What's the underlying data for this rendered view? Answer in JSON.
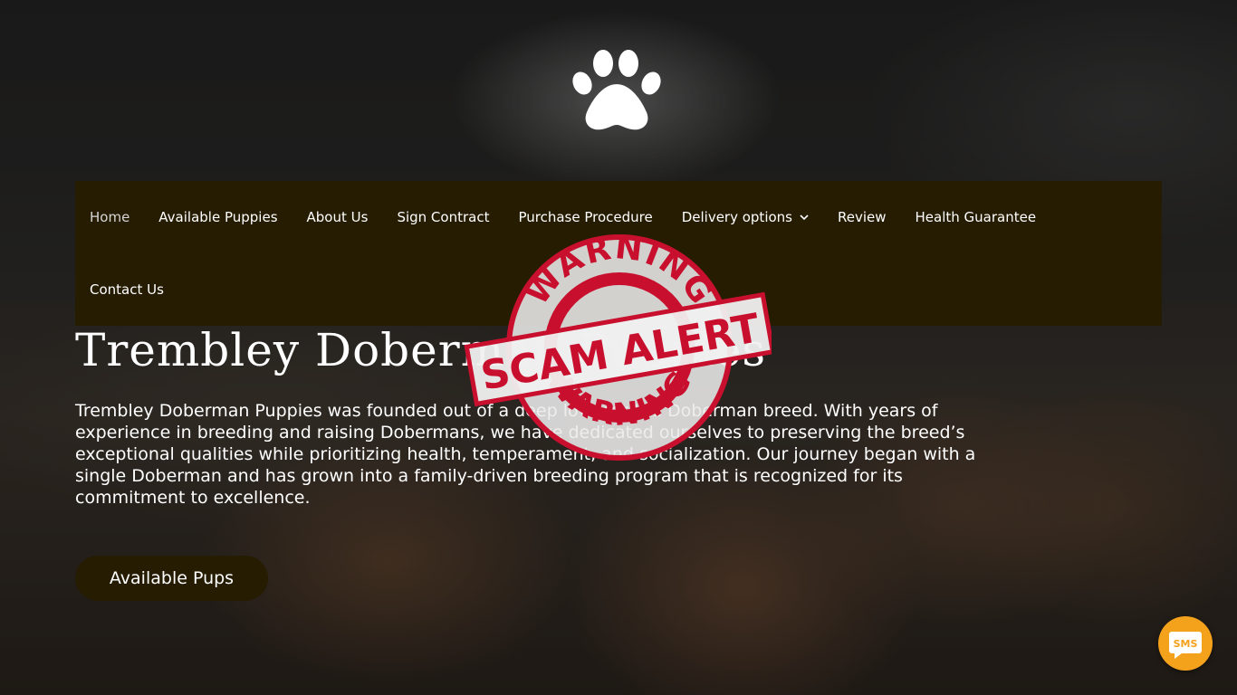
{
  "nav": {
    "row1": [
      {
        "label": "Home",
        "active": true
      },
      {
        "label": "Available Puppies"
      },
      {
        "label": "About Us"
      },
      {
        "label": "Sign Contract"
      },
      {
        "label": "Purchase Procedure"
      },
      {
        "label": "Delivery options",
        "has_dropdown": true
      },
      {
        "label": "Review"
      },
      {
        "label": "Health Guarantee"
      }
    ],
    "row2": [
      {
        "label": "Contact Us"
      }
    ]
  },
  "hero": {
    "title": "Trembley Doberman Puppies",
    "description": "Trembley Doberman Puppies was founded out of a deep love for the Doberman breed. With years of experience in breeding and raising Dobermans, we have dedicated ourselves to preserving the breed’s exceptional qualities while prioritizing health, temperament, and socialization. Our journey began with a single Doberman and has grown into a family-driven breeding program that is recognized for its commitment to excellence.",
    "cta_label": "Available Pups"
  },
  "stamp": {
    "top_text": "WARNING",
    "banner_text": "SCAM ALERT",
    "bottom_text": "WARNING"
  },
  "sms_widget": {
    "label": "SMS"
  },
  "icons": {
    "logo": "paw-print-icon",
    "dropdown": "chevron-down-icon",
    "sms": "sms-chat-icon"
  },
  "colors": {
    "nav_background": "#261c02",
    "cta_background": "#261c02",
    "stamp_red": "#c8102e",
    "sms_orange": "#f4a11b"
  }
}
